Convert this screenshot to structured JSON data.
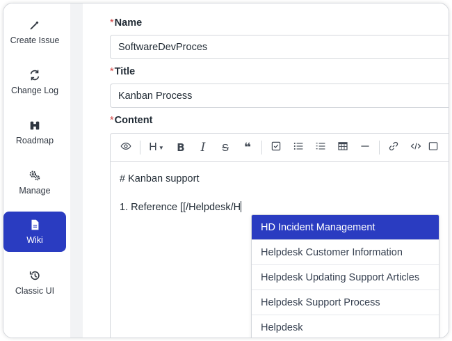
{
  "sidebar": {
    "items": [
      {
        "label": "Create Issue",
        "icon": "edit-icon"
      },
      {
        "label": "Change Log",
        "icon": "refresh-icon"
      },
      {
        "label": "Roadmap",
        "icon": "binoculars-icon"
      },
      {
        "label": "Manage",
        "icon": "gears-icon"
      },
      {
        "label": "Wiki",
        "icon": "document-icon",
        "active": true
      },
      {
        "label": "Classic UI",
        "icon": "history-icon"
      }
    ]
  },
  "form": {
    "required_marker": "*",
    "name_label": "Name",
    "name_value": "SoftwareDevProces",
    "title_label": "Title",
    "title_value": "Kanban Process",
    "content_label": "Content"
  },
  "toolbar": {
    "heading_label": "H",
    "bold_label": "B",
    "italic_label": "I",
    "strike_label": "S",
    "quote_label": "❝"
  },
  "editor": {
    "line1": "# Kanban support",
    "line2": "1. Reference [[/Helpdesk/H"
  },
  "autocomplete": {
    "options": [
      "HD Incident Management",
      "Helpdesk Customer Information",
      "Helpdesk Updating Support Articles",
      "Helpdesk Support Process",
      "Helpdesk"
    ],
    "selected_index": 0
  },
  "colors": {
    "accent": "#2a3cc1",
    "required": "#d14343"
  }
}
